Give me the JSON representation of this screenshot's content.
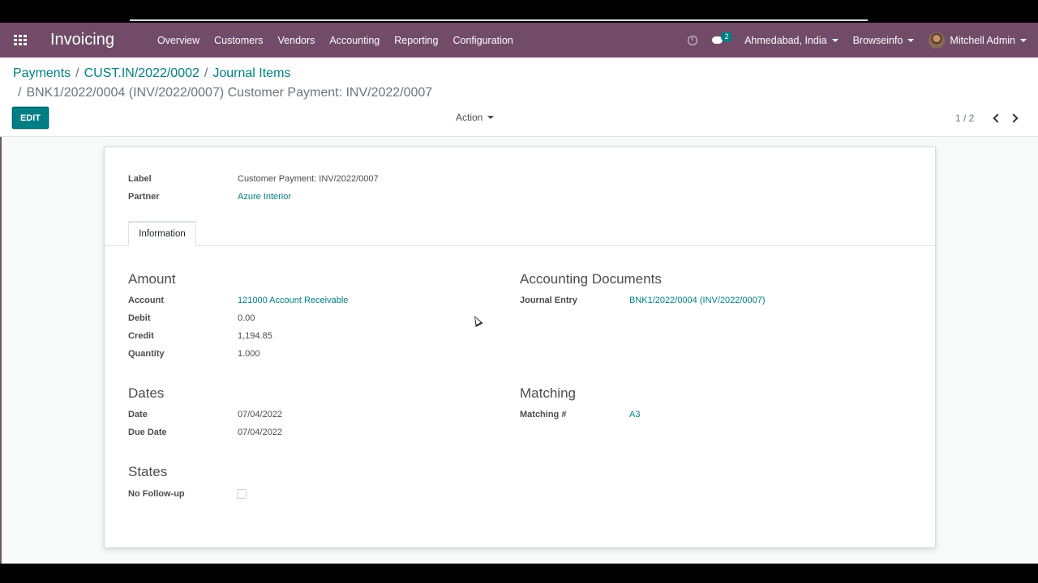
{
  "navbar": {
    "app_title": "Invoicing",
    "menu": [
      "Overview",
      "Customers",
      "Vendors",
      "Accounting",
      "Reporting",
      "Configuration"
    ],
    "chat_count": "2",
    "company_location": "Ahmedabad, India",
    "company": "Browseinfo",
    "user": "Mitchell Admin",
    "color": "#714b67"
  },
  "breadcrumb": {
    "items": [
      "Payments",
      "CUST.IN/2022/0002",
      "Journal Items"
    ],
    "current": "BNK1/2022/0004 (INV/2022/0007) Customer Payment: INV/2022/0007"
  },
  "control": {
    "edit_label": "EDIT",
    "action_label": "Action",
    "pager": "1 / 2"
  },
  "record": {
    "label_caption": "Label",
    "label_value": "Customer Payment: INV/2022/0007",
    "partner_caption": "Partner",
    "partner_value": "Azure Interior"
  },
  "tabs": [
    "Information"
  ],
  "groups": {
    "amount": {
      "title": "Amount",
      "fields": [
        {
          "label": "Account",
          "value": "121000 Account Receivable"
        },
        {
          "label": "Debit",
          "value": "0.00"
        },
        {
          "label": "Credit",
          "value": "1,194.85"
        },
        {
          "label": "Quantity",
          "value": "1.000"
        }
      ]
    },
    "accounting_documents": {
      "title": "Accounting Documents",
      "fields": [
        {
          "label": "Journal Entry",
          "value": "BNK1/2022/0004 (INV/2022/0007)"
        }
      ]
    },
    "dates": {
      "title": "Dates",
      "fields": [
        {
          "label": "Date",
          "value": "07/04/2022"
        },
        {
          "label": "Due Date",
          "value": "07/04/2022"
        }
      ]
    },
    "matching": {
      "title": "Matching",
      "fields": [
        {
          "label": "Matching #",
          "value": "A3"
        }
      ]
    },
    "states": {
      "title": "States",
      "fields": [
        {
          "label": "No Follow-up",
          "checked": false
        }
      ]
    }
  },
  "colors": {
    "accent": "#017e84",
    "navbar": "#714b67"
  }
}
